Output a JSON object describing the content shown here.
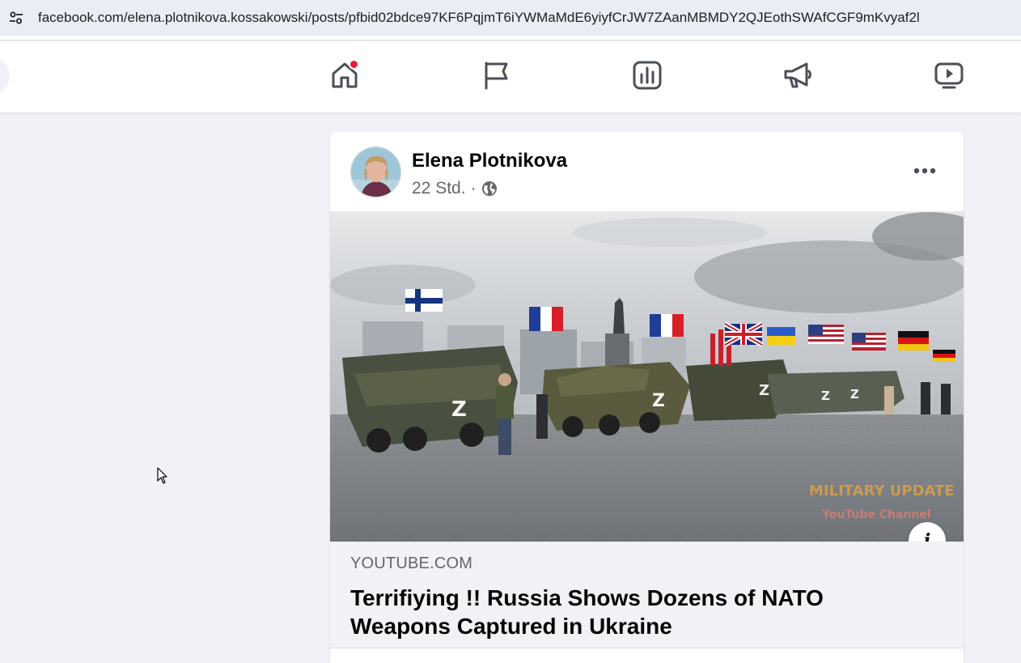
{
  "browser": {
    "url": "facebook.com/elena.plotnikova.kossakowski/posts/pfbid02bdce97KF6PqjmT6iYWMaMdE6yiyfCrJW7ZAanMBMDY2QJEothSWAfCGF9mKvyaf2l",
    "site_icon": "tune-icon"
  },
  "nav": {
    "tabs": [
      {
        "icon": "home-icon",
        "notification": true
      },
      {
        "icon": "flag-icon",
        "notification": false
      },
      {
        "icon": "chart-icon",
        "notification": false
      },
      {
        "icon": "megaphone-icon",
        "notification": false
      },
      {
        "icon": "video-icon",
        "notification": false
      }
    ],
    "notification_color": "#e41e3f"
  },
  "post": {
    "author": "Elena Plotnikova",
    "time": "22 Std.",
    "separator": "·",
    "audience_icon": "globe-icon",
    "image_watermark": {
      "line1": "MILITARY UPDATE",
      "line2": "YouTube Channel"
    },
    "link": {
      "domain": "YOUTUBE.COM",
      "title": "Terrifiying !! Russia Shows Dozens of NATO Weapons Captured in Ukraine"
    }
  }
}
